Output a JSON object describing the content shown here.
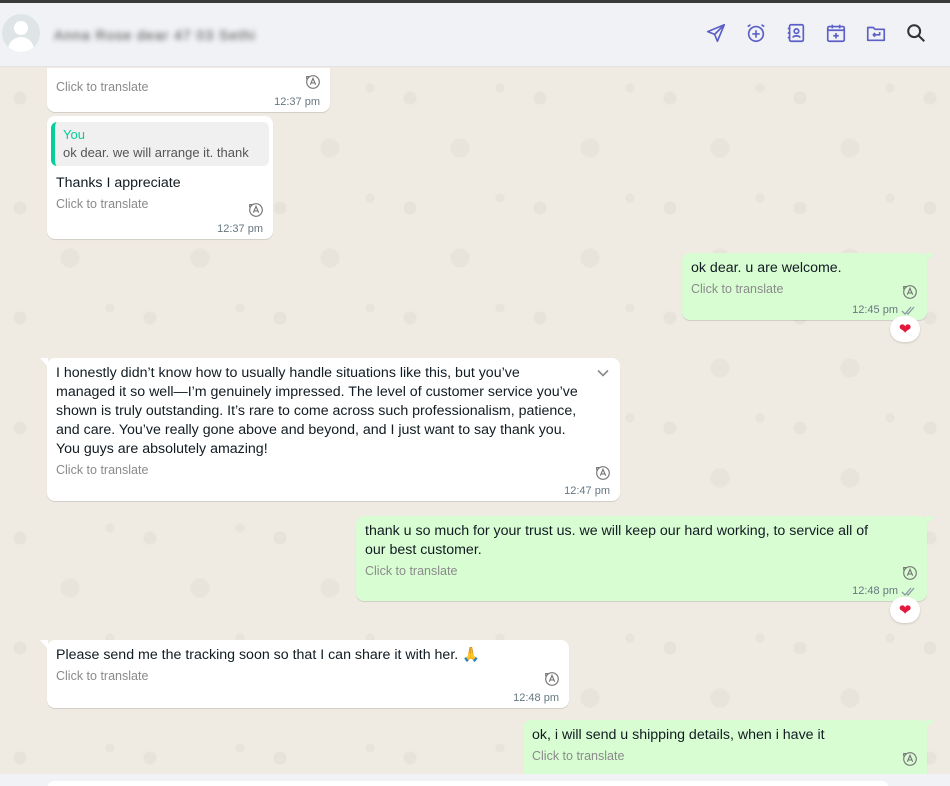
{
  "header": {
    "contact_name": "Anna Rose dear 47 03 Sethi",
    "icons": [
      "send-icon",
      "alarm-add-icon",
      "contact-card-icon",
      "calendar-add-icon",
      "folder-return-icon",
      "search-icon"
    ]
  },
  "messages": [
    {
      "direction": "in",
      "text": "",
      "translate": "Click to translate",
      "time": "12:37 pm"
    },
    {
      "direction": "in",
      "quote_author": "You",
      "quote_text": "ok dear. we will arrange it. thank",
      "text": "Thanks I appreciate",
      "translate": "Click to translate",
      "time": "12:37 pm"
    },
    {
      "direction": "out",
      "text": "ok dear. u are welcome.",
      "translate": "Click to translate",
      "time": "12:45 pm",
      "reaction": "❤"
    },
    {
      "direction": "in",
      "text": "I honestly didn’t know how to usually handle situations like this, but you’ve\nmanaged it so well—I’m genuinely impressed. The level of customer service you’ve\nshown is truly outstanding. It’s rare to come across such professionalism, patience,\nand care. You’ve really gone above and beyond, and I just want to say thank you.\nYou guys are absolutely amazing!",
      "translate": "Click to translate",
      "time": "12:47 pm"
    },
    {
      "direction": "out",
      "text": "thank u so much for your trust us. we will keep our hard working, to service all of\nour best customer.",
      "translate": "Click to translate",
      "time": "12:48 pm",
      "reaction": "❤"
    },
    {
      "direction": "in",
      "text": "Please send me the tracking soon so that I can share it with her. 🙏",
      "translate": "Click to translate",
      "time": "12:48 pm"
    },
    {
      "direction": "out",
      "text": "ok, i will send u shipping details, when i have it",
      "translate": "Click to translate",
      "time": ""
    }
  ],
  "colors": {
    "incoming": "#ffffff",
    "outgoing": "#d9fdd3",
    "accent": "#5b5fc7",
    "quote_accent": "#06cf9c"
  }
}
